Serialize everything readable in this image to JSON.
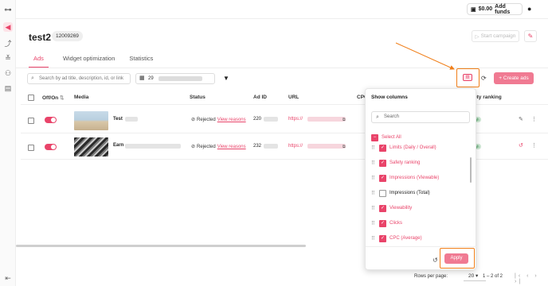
{
  "topbar": {
    "balance": "$0.00",
    "add_funds": "Add funds"
  },
  "campaign": {
    "title": "test2",
    "id": "12009269",
    "start_label": "Start campaign"
  },
  "tabs": [
    {
      "label": "Ads"
    },
    {
      "label": "Widget optimization"
    },
    {
      "label": "Statistics"
    }
  ],
  "toolbar": {
    "search_placeholder": "Search by ad title, description, id, or link",
    "date_prefix": "29",
    "create_label": "Create ads"
  },
  "table": {
    "headers": {
      "off_on": "Off/On",
      "media": "Media",
      "status": "Status",
      "ad_id": "Ad ID",
      "url": "URL",
      "cpc": "CPC",
      "safety": "ety ranking"
    },
    "rows": [
      {
        "name": "Test",
        "status": "Rejected",
        "view": "View reasons",
        "ad_id": "220",
        "url": "https://"
      },
      {
        "name": "Earn",
        "status": "Rejected",
        "view": "View reasons",
        "ad_id": "232",
        "url": "https://"
      }
    ]
  },
  "columns_panel": {
    "title": "Show columns",
    "search_placeholder": "Search",
    "select_all": "Select All",
    "options": [
      {
        "label": "Limits (Daily / Overall)",
        "checked": true
      },
      {
        "label": "Safety ranking",
        "checked": true
      },
      {
        "label": "Impressions (Viewable)",
        "checked": true
      },
      {
        "label": "Impressions (Total)",
        "checked": false
      },
      {
        "label": "Viewability",
        "checked": true
      },
      {
        "label": "Clicks",
        "checked": true
      },
      {
        "label": "CPC (Average)",
        "checked": true
      }
    ],
    "apply_label": "Apply"
  },
  "footer": {
    "rows_label": "Rows per page:",
    "rows_value": "20",
    "range": "1 – 2 of 2"
  },
  "colors": {
    "accent": "#e9446a",
    "highlight": "#f07f1a"
  }
}
